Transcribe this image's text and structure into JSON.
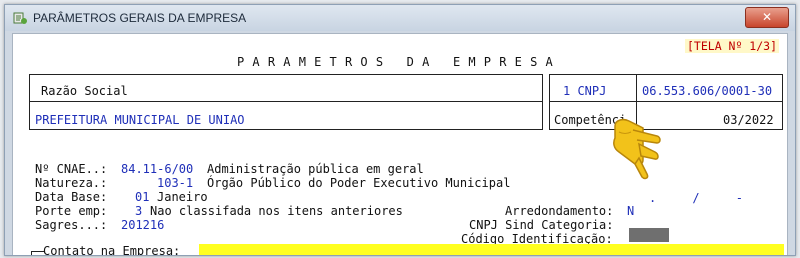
{
  "window": {
    "title": "PARÂMETROS GERAIS DA EMPRESA",
    "close_glyph": "✕"
  },
  "screen": {
    "tela": "[TELA Nº 1/3]",
    "heading": "PARAMETROS DA EMPRESA",
    "razao_label": "Razão Social",
    "razao_value": "PREFEITURA MUNICIPAL DE UNIAO",
    "cnpj_label": "1 CNPJ",
    "cnpj_value": "06.553.606/0001-30",
    "competencia_label": "Competênci",
    "competencia_value": "03/2022"
  },
  "fields": {
    "cnae_label": "Nº CNAE..:",
    "cnae_code": "84.11-6/00",
    "cnae_desc": "Administração pública em geral",
    "natureza_label": "Natureza.:",
    "natureza_code": "103-1",
    "natureza_desc": "Órgão Público do Poder Executivo Municipal",
    "database_label": "Data Base:",
    "database_code": "01",
    "database_desc": "Janeiro",
    "porte_label": "Porte emp:",
    "porte_code": "3",
    "porte_desc": "Nao classifada nos itens anteriores",
    "sagres_label": "Sagres...:",
    "sagres_value": "201216",
    "cnpj_sind_label": "CNPJ Sind Categoria:",
    "cnpj_sind_value": ".     /     -",
    "arredondamento_label": "Arredondamento:",
    "arredondamento_value": "N",
    "codigo_label": "Código Identificação:",
    "contato_label": "Contato na Empresa:"
  },
  "colors": {
    "label": "#111111",
    "value": "#1f2fb8",
    "tela": "#c00000",
    "highlight": "#ffff20"
  },
  "icons": {
    "title": "app-icon",
    "pointer": "pointing-hand-cursor-icon",
    "close": "close-icon"
  }
}
